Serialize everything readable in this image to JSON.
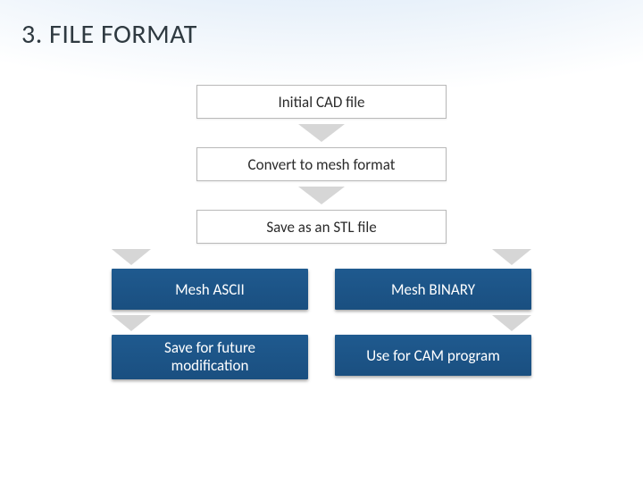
{
  "title": "3. FILE FORMAT",
  "steps": {
    "s1": "Initial CAD file",
    "s2": "Convert to mesh format",
    "s3": "Save as an STL file"
  },
  "branch": {
    "left1": "Mesh ASCII",
    "right1": "Mesh BINARY",
    "left2_a": "Save for  future",
    "left2_b": "modification",
    "right2": "Use for CAM program"
  }
}
